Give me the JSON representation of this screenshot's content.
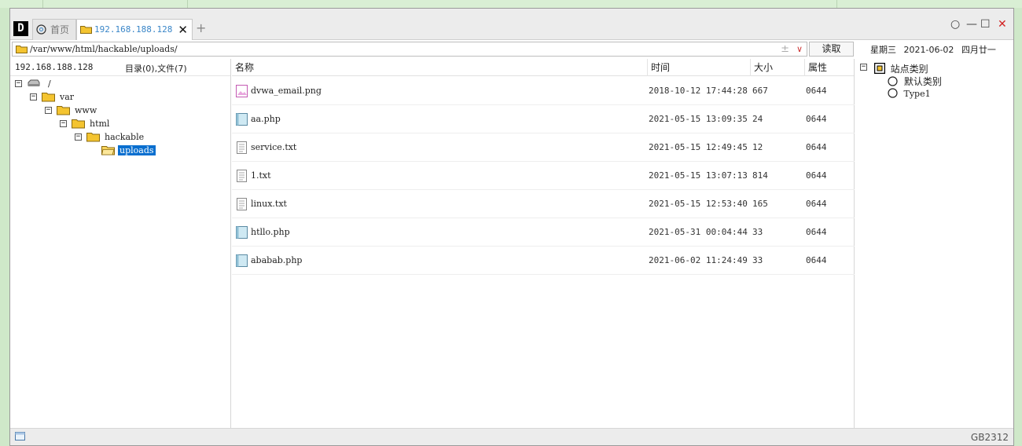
{
  "tabs": {
    "app_logo": "D",
    "home_label": "首页",
    "active_label": "192.168.188.128",
    "close_glyph": "✕",
    "add_glyph": "+"
  },
  "window_controls": {
    "circle": "○",
    "minimize": "—",
    "maximize": "☐",
    "close": "✕"
  },
  "pathbar": {
    "path": "/var/www/html/hackable/uploads/",
    "plus_glyph": "±",
    "dropdown_glyph": "∨",
    "read_button": "读取"
  },
  "datebar": {
    "weekday": "星期三",
    "date": "2021-06-02",
    "lunar": "四月廿一"
  },
  "left": {
    "host": "192.168.188.128",
    "summary": "目录(0),文件(7)",
    "tree": [
      {
        "label": "/",
        "toggle": "−",
        "type": "drive",
        "selected": false
      },
      {
        "label": "var",
        "toggle": "−",
        "type": "folder",
        "selected": false
      },
      {
        "label": "www",
        "toggle": "−",
        "type": "folder",
        "selected": false
      },
      {
        "label": "html",
        "toggle": "−",
        "type": "folder",
        "selected": false
      },
      {
        "label": "hackable",
        "toggle": "−",
        "type": "folder",
        "selected": false
      },
      {
        "label": "uploads",
        "toggle": "",
        "type": "folder-open",
        "selected": true
      }
    ]
  },
  "list": {
    "headers": {
      "name": "名称",
      "time": "时间",
      "size": "大小",
      "perm": "属性"
    },
    "rows": [
      {
        "name": "dvwa_email.png",
        "time": "2018-10-12 17:44:28",
        "size": "667",
        "perm": "0644",
        "icon": "image-file-icon"
      },
      {
        "name": "aa.php",
        "time": "2021-05-15 13:09:35",
        "size": "24",
        "perm": "0644",
        "icon": "php-file-icon"
      },
      {
        "name": "service.txt",
        "time": "2021-05-15 12:49:45",
        "size": "12",
        "perm": "0644",
        "icon": "text-file-icon"
      },
      {
        "name": "1.txt",
        "time": "2021-05-15 13:07:13",
        "size": "814",
        "perm": "0644",
        "icon": "text-file-icon"
      },
      {
        "name": "linux.txt",
        "time": "2021-05-15 12:53:40",
        "size": "165",
        "perm": "0644",
        "icon": "text-file-icon"
      },
      {
        "name": "htllo.php",
        "time": "2021-05-31 00:04:44",
        "size": "33",
        "perm": "0644",
        "icon": "php-file-icon"
      },
      {
        "name": "ababab.php",
        "time": "2021-06-02 11:24:49",
        "size": "33",
        "perm": "0644",
        "icon": "php-file-icon"
      }
    ]
  },
  "categories": {
    "root": "站点类别",
    "toggle": "−",
    "children": [
      "默认类别",
      "Type1"
    ]
  },
  "status": {
    "encoding": "GB2312"
  },
  "colors": {
    "accent": "#0a6fcf",
    "tab_active_text": "#3a86c8",
    "close_red": "#d22222",
    "folder": "#f4c430"
  }
}
